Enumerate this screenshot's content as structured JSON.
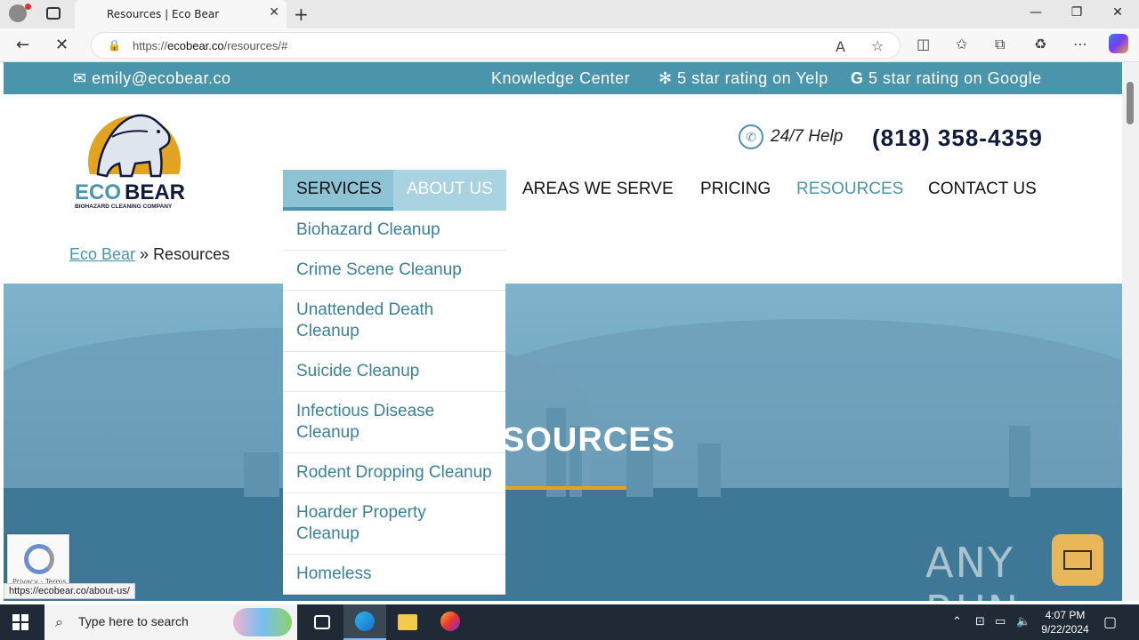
{
  "browser": {
    "tab_title": "Resources | Eco Bear",
    "url_prefix": "https://",
    "url_domain": "ecobear.co",
    "url_path": "/resources/#",
    "status_url": "https://ecobear.co/about-us/"
  },
  "topbar": {
    "email": "emily@ecobear.co",
    "knowledge": "Knowledge Center",
    "yelp": "5 star rating on Yelp",
    "google": "5 star rating on Google"
  },
  "logo": {
    "brand_eco": "ECO",
    "brand_bear": "BEAR",
    "tagline": "BIOHAZARD CLEANING COMPANY"
  },
  "help": {
    "label": "24/7 Help",
    "phone": "(818) 358-4359"
  },
  "nav": {
    "services": "SERVICES",
    "about": "ABOUT US",
    "areas": "AREAS WE SERVE",
    "pricing": "PRICING",
    "resources": "RESOURCES",
    "contact": "CONTACT US"
  },
  "breadcrumb": {
    "home": "Eco Bear",
    "sep": " » ",
    "current": "Resources"
  },
  "dropdown": {
    "items": [
      "Biohazard Cleanup",
      "Crime Scene Cleanup",
      "Unattended Death Cleanup",
      "Suicide Cleanup",
      "Infectious Disease Cleanup",
      "Rodent Dropping Cleanup",
      "Hoarder Property Cleanup",
      "Homeless"
    ]
  },
  "hero": {
    "title": "SOURCES"
  },
  "recaptcha": {
    "text": "Privacy - Terms"
  },
  "watermark": "ANY RUN",
  "taskbar": {
    "search_placeholder": "Type here to search",
    "time": "4:07 PM",
    "date": "9/22/2024"
  },
  "colors": {
    "accent": "#4a94ac",
    "brand_navy": "#101a3a",
    "gold": "#e3a322"
  }
}
